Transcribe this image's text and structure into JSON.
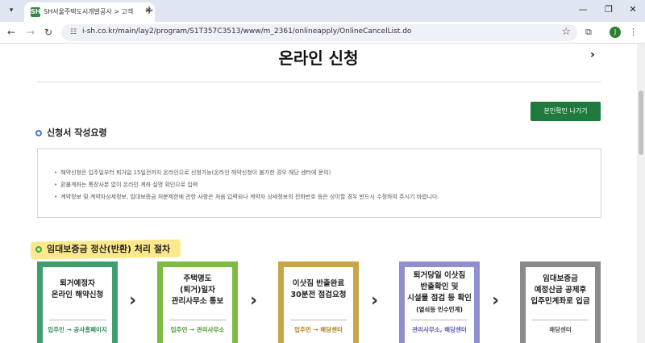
{
  "browser": {
    "tab_title": "SH서울주택도시개발공사 > 고객",
    "favicon_text": "SH",
    "url": "i-sh.co.kr/main/lay2/program/S1T357C3513/www/m_2361/onlineapply/OnlineCancelList.do",
    "profile_initial": "J"
  },
  "page": {
    "title": "온라인 신청",
    "verify_button": "본인확인 나가기",
    "guide_heading": "신청서 작성요령",
    "guide_items": [
      "해약신청은 입주일부터 퇴거일 15일전까지 온라인으로 신청가능(온라인 해약신청이 불가한 경우 해당 센터에 문의)",
      "환불계좌는 통장사본 없이 온라인 계좌 실명 확인으로 입력",
      "계약정보 및 계약자상세정보, 임대보증금 처분제한에 관한 사항은 처음 입력되나 계약자 상세정보의 전화번호 등은 상이할 경우 반드시 수정하여 주시기 바랍니다."
    ],
    "process_heading": "임대보증금 정산(반환) 처리 절차"
  },
  "steps": [
    {
      "title": "퇴거예정자\n온라인 해약신청",
      "sub": "",
      "who": "입주민 → 공사홈페이지",
      "color": "#3f9e6e",
      "who_color": "#2e8b57"
    },
    {
      "title": "주택명도\n(퇴거)일자\n관리사무소 통보",
      "sub": "",
      "who": "입주민 → 관리사무소",
      "color": "#7dbb42",
      "who_color": "#4c9a2a"
    },
    {
      "title": "이삿짐 반출완료\n30분전 점검요청",
      "sub": "",
      "who": "입주민 → 해당센터",
      "color": "#c9a54a",
      "who_color": "#b07d1a"
    },
    {
      "title": "퇴거당일 이삿짐\n반출확인 및\n시설물 점검 등 확인",
      "sub": "(열쇠등 인수인계)",
      "who": "관리사무소, 해당센터",
      "color": "#8f8fcf",
      "who_color": "#5c5cb3"
    },
    {
      "title": "임대보증금\n예정산금 공제후\n입주민계좌로 입금",
      "sub": "",
      "who": "해당센터",
      "color": "#8a8a8a",
      "who_color": "#555555"
    }
  ]
}
